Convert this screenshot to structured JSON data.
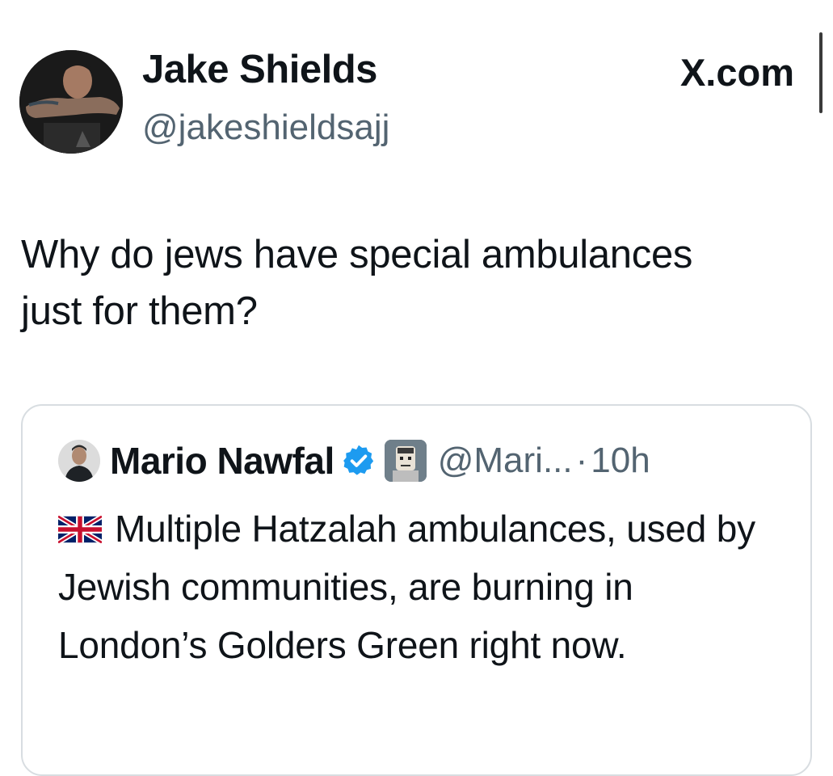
{
  "tweet": {
    "author": {
      "display_name": "Jake Shields",
      "handle": "@jakeshieldsajj",
      "avatar_icon": "profile-photo"
    },
    "source_label": "X.com",
    "text": "Why do jews have special ambulances just for them?"
  },
  "quoted_tweet": {
    "author": {
      "display_name": "Mario Nawfal",
      "handle": "@Mari...",
      "avatar_icon": "profile-photo",
      "verified_icon": "verified-badge-icon",
      "affiliate_icon": "affiliate-badge-icon"
    },
    "separator": "·",
    "time": "10h",
    "flag_icon": "uk-flag-icon",
    "text": "Multiple Hatzalah ambulances, used by Jewish communities, are burning in London’s Golders Green right now."
  },
  "colors": {
    "text_primary": "#0f1419",
    "text_secondary": "#536471",
    "card_border": "#d8dde1",
    "verified_blue": "#1d9bf0"
  }
}
